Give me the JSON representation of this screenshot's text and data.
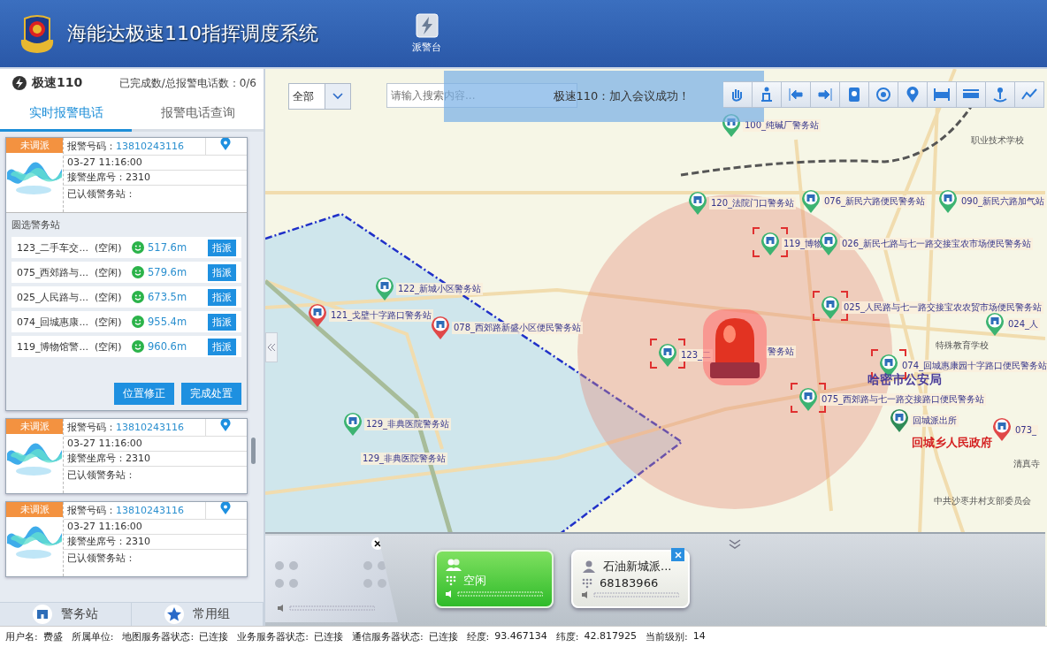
{
  "header": {
    "title": "海能达极速110指挥调度系统",
    "nav_button": "派警台"
  },
  "sidebar": {
    "brand": "极速110",
    "progress": "已完成数/总报警电话数：0/6",
    "tabs": [
      {
        "label": "实时报警电话",
        "selected": true
      },
      {
        "label": "报警电话查询",
        "selected": false
      }
    ],
    "cards": [
      {
        "status": "未调派",
        "phone_label": "报警号码：",
        "phone": "13810243116",
        "time": "03-27 11:16:00",
        "seat": "接警坐席号：2310",
        "claimed": "已认领警务站：",
        "expanded": true,
        "stations_title": "圆选警务站",
        "stations": [
          {
            "name": "123_二手车交...",
            "state": "(空闲)",
            "distance": "517.6m",
            "action": "指派"
          },
          {
            "name": "075_西郊路与...",
            "state": "(空闲)",
            "distance": "579.6m",
            "action": "指派"
          },
          {
            "name": "025_人民路与...",
            "state": "(空闲)",
            "distance": "673.5m",
            "action": "指派"
          },
          {
            "name": "074_回城惠康...",
            "state": "(空闲)",
            "distance": "955.4m",
            "action": "指派"
          },
          {
            "name": "119_博物馆警...",
            "state": "(空闲)",
            "distance": "960.6m",
            "action": "指派"
          }
        ],
        "actions": [
          "位置修正",
          "完成处置"
        ]
      },
      {
        "status": "未调派",
        "phone_label": "报警号码：",
        "phone": "13810243116",
        "time": "03-27 11:16:00",
        "seat": "接警坐席号：2310",
        "claimed": "已认领警务站：",
        "expanded": false
      },
      {
        "status": "未调派",
        "phone_label": "报警号码：",
        "phone": "13810243116",
        "time": "03-27 11:16:00",
        "seat": "接警坐席号：2310",
        "claimed": "已认领警务站：",
        "expanded": false
      }
    ],
    "bottom_tabs": [
      {
        "label": "警务站",
        "kind": "station"
      },
      {
        "label": "常用组",
        "kind": "star"
      }
    ]
  },
  "map": {
    "filter": "全部",
    "search_placeholder": "请输入搜索内容...",
    "toast": "极速110：加入会议成功！",
    "markers": [
      {
        "label": "100_纯碱厂警务站",
        "color": "#3cb371",
        "highlighted": false
      },
      {
        "label": "120_法院门口警务站",
        "color": "#3cb371",
        "highlighted": false
      },
      {
        "label": "076_新民六路便民警务站",
        "color": "#3cb371",
        "highlighted": false
      },
      {
        "label": "090_新民六路加气站",
        "color": "#3cb371",
        "highlighted": false
      },
      {
        "label": "119_博物",
        "color": "#3cb371",
        "highlighted": true
      },
      {
        "label": "026_新民七路与七一路交接宝农市场便民警务站",
        "color": "#3cb371",
        "highlighted": false
      },
      {
        "label": "122_新城小区警务站",
        "color": "#3cb371",
        "highlighted": false
      },
      {
        "label": "121_戈壁十字路口警务站",
        "color": "#e04848",
        "highlighted": false
      },
      {
        "label": "078_西郊路新盛小区便民警务站",
        "color": "#e04848",
        "highlighted": false
      },
      {
        "label": "025_人民路与七一路交接宝农农贸市场便民警务站",
        "color": "#3cb371",
        "highlighted": true
      },
      {
        "label": "024_人",
        "color": "#3cb371",
        "highlighted": false
      },
      {
        "label": "123_二",
        "color": "#3cb371",
        "highlighted": true
      },
      {
        "label": "074_回城惠康园十字路口便民警务站",
        "color": "#3cb371",
        "highlighted": true
      },
      {
        "label": "075_西郊路与七一路交接路口便民警务站",
        "color": "#3cb371",
        "highlighted": true
      },
      {
        "label": "回城派出所",
        "color": "#2e8b57",
        "highlighted": false
      },
      {
        "label": "073_",
        "color": "#e04848",
        "highlighted": false
      },
      {
        "label": "129_非典医院警务站",
        "color": "#3cb371",
        "highlighted": false
      }
    ],
    "places": [
      {
        "text": "警务站",
        "kind": "label"
      },
      {
        "text": "129_非典医院警务站",
        "kind": "label"
      },
      {
        "text": "职业技术学校",
        "kind": "poi"
      },
      {
        "text": "特殊教育学校",
        "kind": "poi"
      },
      {
        "text": "哈密市公安局",
        "kind": "landmark"
      },
      {
        "text": "回城乡人民政府",
        "kind": "government"
      },
      {
        "text": "清真寺",
        "kind": "poi"
      },
      {
        "text": "中共沙枣井村支部委员会",
        "kind": "poi"
      }
    ],
    "dock": {
      "calls": [
        {
          "kind": "idle",
          "status": "空闲"
        },
        {
          "kind": "contact",
          "name": "石油新城派...",
          "number": "68183966"
        }
      ]
    }
  },
  "status_bar": [
    {
      "label": "用户名:",
      "value": "费盛"
    },
    {
      "label": "所属单位:"
    },
    {
      "label": "地图服务器状态:",
      "value": "已连接"
    },
    {
      "label": "业务服务器状态:",
      "value": "已连接"
    },
    {
      "label": "通信服务器状态:",
      "value": "已连接"
    },
    {
      "label": "经度:",
      "value": "93.467134"
    },
    {
      "label": "纬度:",
      "value": "42.817925"
    },
    {
      "label": "当前级别:",
      "value": "14"
    }
  ]
}
